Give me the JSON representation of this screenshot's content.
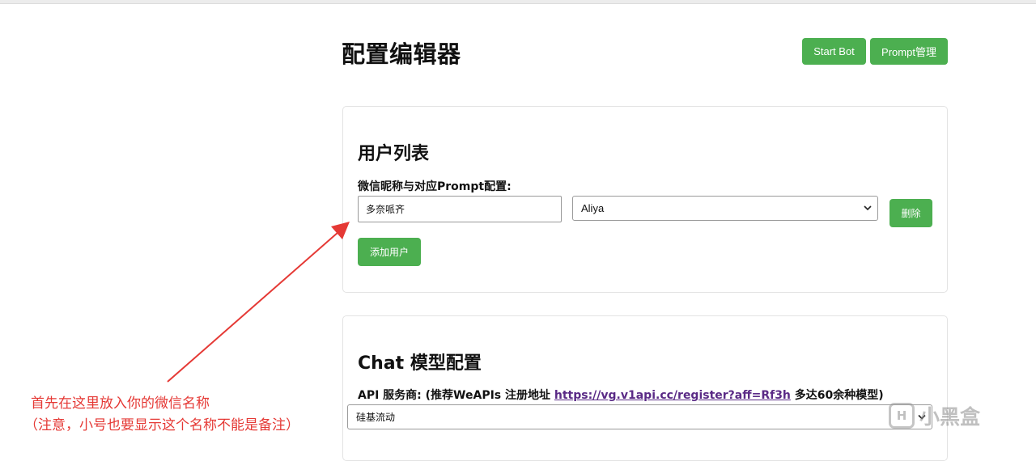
{
  "page": {
    "title": "配置编辑器"
  },
  "header_buttons": {
    "start_bot": "Start Bot",
    "prompt_manage": "Prompt管理"
  },
  "users_card": {
    "title": "用户列表",
    "field_label": "微信昵称与对应Prompt配置:",
    "nickname_value": "多奈哌齐",
    "prompt_selected": "Aliya",
    "delete_label": "删除",
    "add_user_label": "添加用户"
  },
  "chat_card": {
    "title": "Chat 模型配置",
    "api_label_prefix": "API 服务商: (推荐WeAPIs 注册地址",
    "api_link": "https://vg.v1api.cc/register?aff=Rf3h",
    "api_label_suffix": "多达60余种模型)",
    "provider_selected": "硅基流动"
  },
  "annotation": {
    "line1": "首先在这里放入你的微信名称",
    "line2": "（注意，小号也要显示这个名称不能是备注）",
    "color": "#e53935"
  },
  "watermark": {
    "logo_text": "H",
    "text": "小黑盒"
  },
  "colors": {
    "accent": "#4caf50",
    "link": "#5a2a86"
  },
  "icons": {
    "select_arrow": "chevron-down-icon"
  }
}
